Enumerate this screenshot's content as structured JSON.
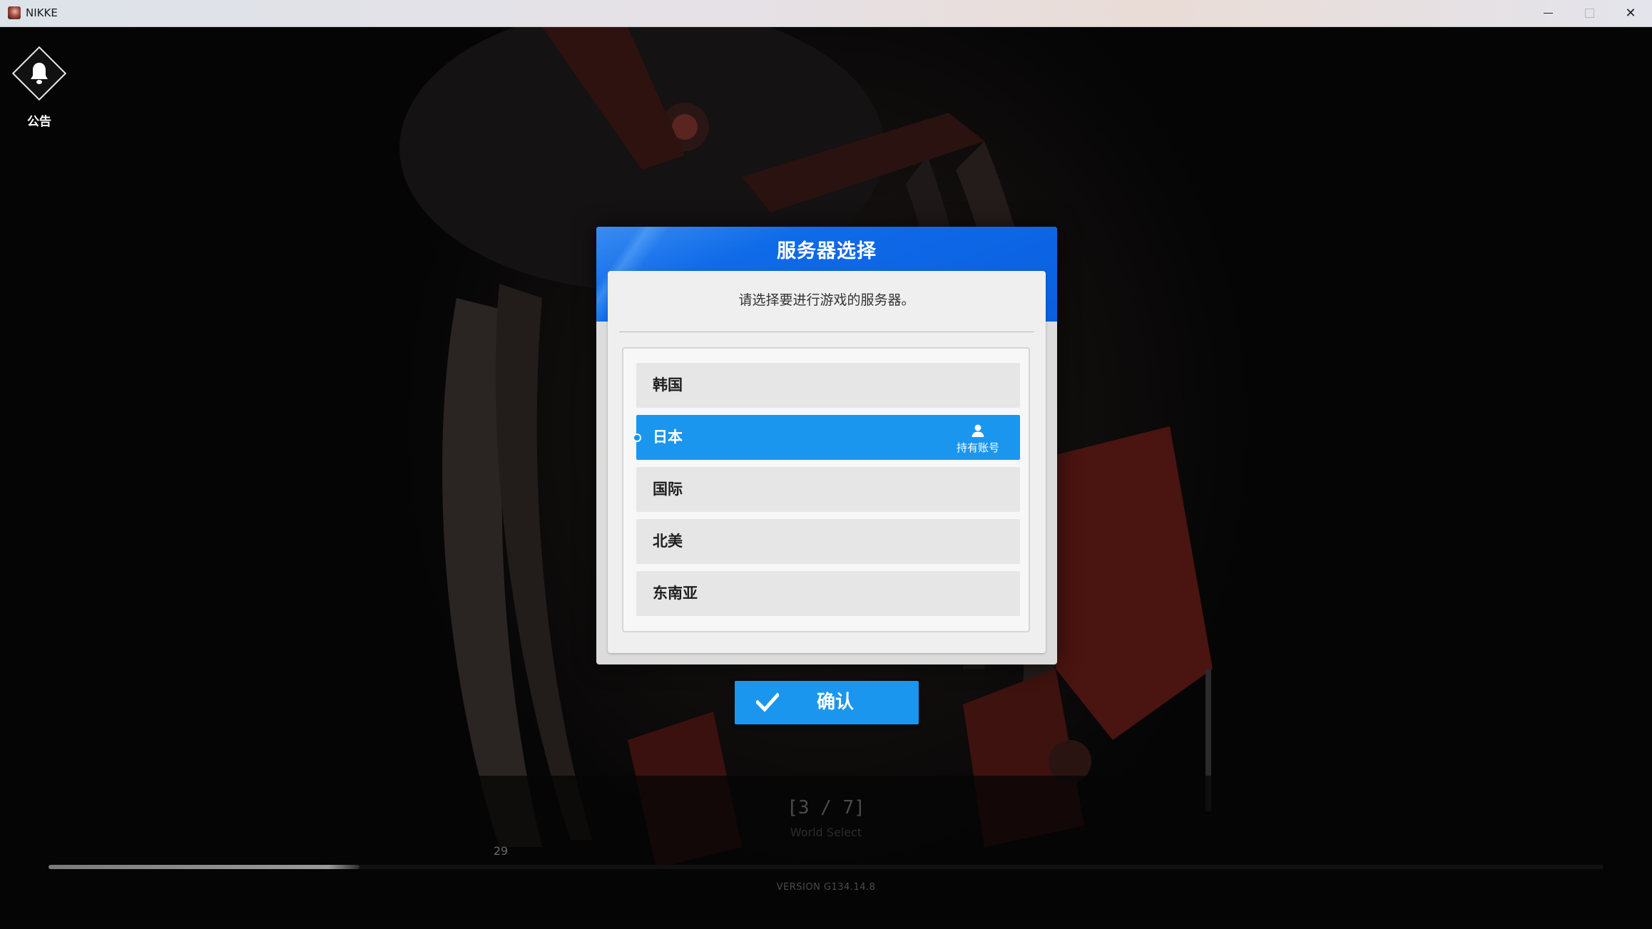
{
  "window": {
    "title": "NIKKE",
    "minimize_icon": "minimize-icon",
    "maximize_icon": "maximize-icon",
    "close_icon": "close-icon",
    "close_glyph": "✕"
  },
  "notice": {
    "label": "公告",
    "icon": "bell-icon"
  },
  "dialog": {
    "title": "服务器选择",
    "subtitle": "请选择要进行游戏的服务器。",
    "servers": [
      {
        "label": "韩国",
        "selected": false
      },
      {
        "label": "日本",
        "selected": true,
        "badge": "持有账号"
      },
      {
        "label": "国际",
        "selected": false
      },
      {
        "label": "北美",
        "selected": false
      },
      {
        "label": "东南亚",
        "selected": false
      }
    ],
    "accent_color": "#1a96ee",
    "header_color": "#0f6be8"
  },
  "confirm": {
    "label": "确认",
    "icon": "checkmark-icon"
  },
  "status": {
    "step": "[3 / 7]",
    "step_name": "World Select",
    "progress_label": "29",
    "progress_percent": 20,
    "version": "VERSION  G134.14.8"
  }
}
